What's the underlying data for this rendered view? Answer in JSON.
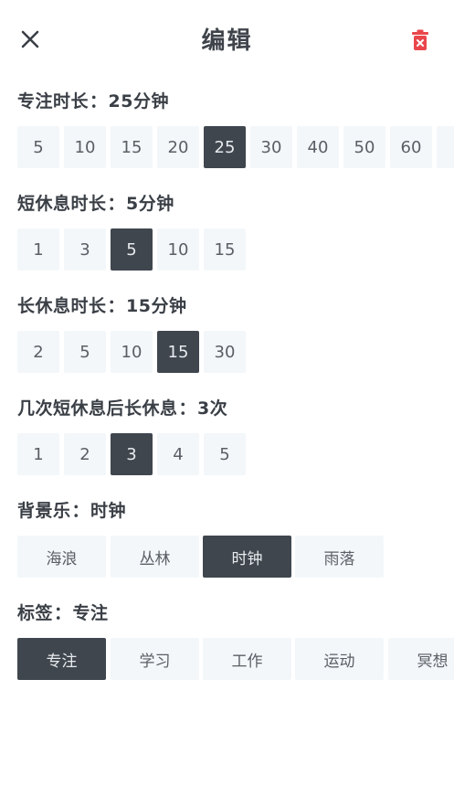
{
  "header": {
    "title": "编辑",
    "close_icon": "close-icon",
    "delete_icon": "trash-icon",
    "delete_color": "#e9474c"
  },
  "colors": {
    "chip_bg": "#f3f7fa",
    "chip_active_bg": "#3f464e",
    "chip_text": "#5a5f66",
    "chip_active_text": "#e8ebee"
  },
  "focus": {
    "label": "专注时长",
    "colon": "：",
    "value": "25分钟",
    "options": [
      "5",
      "10",
      "15",
      "20",
      "25",
      "30",
      "40",
      "50",
      "60"
    ],
    "selected": "25"
  },
  "short_break": {
    "label": "短休息时长",
    "colon": "：",
    "value": "5分钟",
    "options": [
      "1",
      "3",
      "5",
      "10",
      "15"
    ],
    "selected": "5"
  },
  "long_break": {
    "label": "长休息时长",
    "colon": "：",
    "value": "15分钟",
    "options": [
      "2",
      "5",
      "10",
      "15",
      "30"
    ],
    "selected": "15"
  },
  "interval": {
    "label": "几次短休息后长休息",
    "colon": "：",
    "value": "3次",
    "options": [
      "1",
      "2",
      "3",
      "4",
      "5"
    ],
    "selected": "3"
  },
  "music": {
    "label": "背景乐",
    "colon": "：",
    "value": "时钟",
    "options": [
      "海浪",
      "丛林",
      "时钟",
      "雨落"
    ],
    "selected": "时钟"
  },
  "tag": {
    "label": "标签",
    "colon": "：",
    "value": "专注",
    "options": [
      "专注",
      "学习",
      "工作",
      "运动",
      "冥想"
    ],
    "selected": "专注"
  }
}
